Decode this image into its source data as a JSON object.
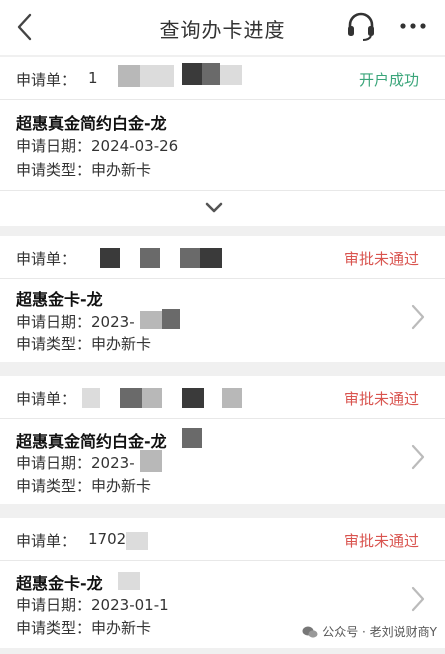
{
  "header": {
    "title": "查询办卡进度"
  },
  "labels": {
    "application": "申请单：",
    "date": "申请日期：",
    "type": "申请类型："
  },
  "cards": [
    {
      "app_no": "1",
      "status": "开户成功",
      "name": "超惠真金简约白金-龙",
      "date": "2024-03-26",
      "type": "申办新卡"
    },
    {
      "app_no": "",
      "status": "审批未通过",
      "name": "超惠金卡-龙",
      "date": "2023-",
      "type": "申办新卡"
    },
    {
      "app_no": "",
      "status": "审批未通过",
      "name": "超惠真金简约白金-龙",
      "date": "2023-",
      "type": "申办新卡"
    },
    {
      "app_no": "17022",
      "status": "审批未通过",
      "name": "超惠金卡-龙",
      "date": "2023-01-1",
      "type": "申办新卡"
    }
  ],
  "watermark": {
    "text": "公众号 · 老刘说财商Y"
  },
  "colors": {
    "success": "#3aa57a",
    "fail": "#d9544f"
  }
}
